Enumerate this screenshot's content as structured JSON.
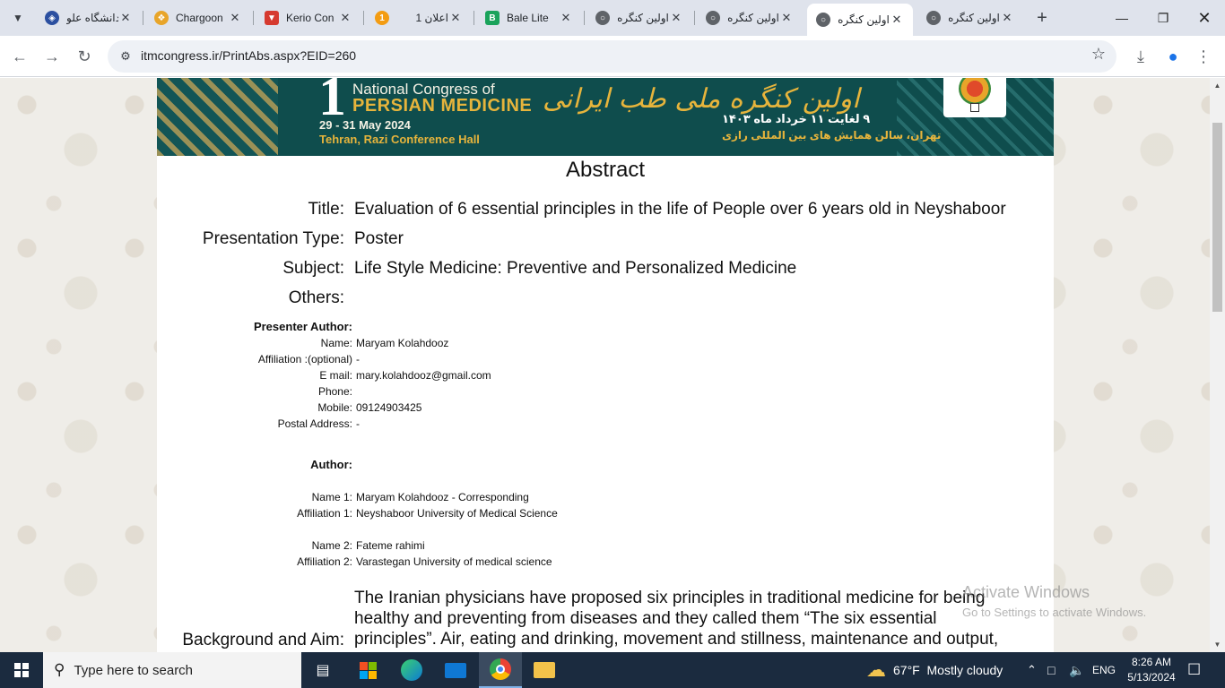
{
  "browser": {
    "tabs": [
      {
        "label": "دانشگاه علو",
        "favicon": "shield-blue"
      },
      {
        "label": "Chargoon",
        "favicon": "chargoon-orange"
      },
      {
        "label": "Kerio Con",
        "favicon": "kerio-red"
      },
      {
        "label": "1 اعلان",
        "favicon": "notification-orange"
      },
      {
        "label": "Bale Lite",
        "favicon": "bale-green"
      },
      {
        "label": "اولین کنگره",
        "favicon": "globe"
      },
      {
        "label": "اولین کنگره",
        "favicon": "globe"
      },
      {
        "label": "اولین کنگره",
        "favicon": "globe",
        "active": true
      },
      {
        "label": "اولین کنگره",
        "favicon": "globe"
      }
    ],
    "url": "itmcongress.ir/PrintAbs.aspx?EID=260"
  },
  "banner": {
    "numeral": "1",
    "title_line1": "National Congress of",
    "title_line2": "PERSIAN MEDICINE",
    "date": "29 - 31 May 2024",
    "venue": "Tehran, Razi Conference Hall",
    "fa_title": "اولین کنگره ملی طب ایرانی",
    "fa_date": "۹ لغایت ۱۱ خرداد ماه ۱۴۰۳",
    "fa_venue": "تهران، سالن همایش های بین المللی رازی"
  },
  "abstract": {
    "heading": "Abstract",
    "title_label": "Title:",
    "title_value": "Evaluation of 6 essential principles in the life of People over 6 years old in Neyshaboor",
    "type_label": "Presentation Type:",
    "type_value": "Poster",
    "subject_label": "Subject:",
    "subject_value": "Life Style Medicine: Preventive and Personalized Medicine",
    "others_label": "Others:",
    "presenter": {
      "heading": "Presenter Author:",
      "name_label": "Name:",
      "name": "Maryam Kolahdooz",
      "affiliation_label": "Affiliation :(optional)",
      "affiliation": "-",
      "email_label": "E mail:",
      "email": "mary.kolahdooz@gmail.com",
      "phone_label": "Phone:",
      "phone": "",
      "mobile_label": "Mobile:",
      "mobile": "09124903425",
      "postal_label": "Postal Address:",
      "postal": "-"
    },
    "authors": {
      "heading": "Author:",
      "name1_label": "Name 1:",
      "name1": "Maryam Kolahdooz - Corresponding",
      "aff1_label": "Affiliation 1:",
      "aff1": "Neyshaboor University of Medical Science",
      "name2_label": "Name 2:",
      "name2": "Fateme rahimi",
      "aff2_label": "Affiliation 2:",
      "aff2": "Varastegan University of medical science"
    },
    "background_label": "Background and Aim:",
    "background_text": "The Iranian physicians have proposed six principles in traditional medicine for being healthy and preventing from diseases and they called them “The six essential principles”. Air, eating and drinking, movement and stillness, maintenance and output, feelings, sleep"
  },
  "watermark": {
    "line1": "Activate Windows",
    "line2": "Go to Settings to activate Windows."
  },
  "taskbar": {
    "search_placeholder": "Type here to search",
    "weather": "67°F  Mostly cloudy",
    "lang": "ENG",
    "time": "8:26 AM",
    "date": "5/13/2024"
  }
}
